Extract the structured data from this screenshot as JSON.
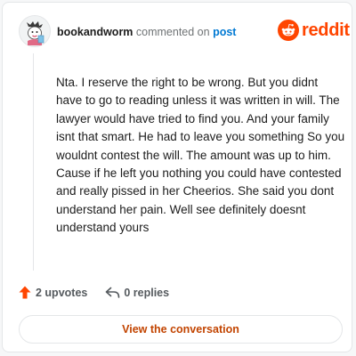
{
  "header": {
    "username": "bookandworm",
    "action_text": "commented on",
    "post_link": "post"
  },
  "brand": {
    "wordmark": "reddit",
    "color": "#ff4500",
    "icon": "reddit-snoo-icon"
  },
  "comment": {
    "body": "Nta. I reserve the right to be wrong. But you didnt have to go to reading unless it was written in will. The lawyer would have tried to find you. And your family isnt that smart. He had to leave you something So you wouldnt contest the will. The amount was up to him. Cause if he left you nothing you could have contested and really pissed in her Cheerios. She said you dont understand her pain. Well see definitely doesnt understand yours"
  },
  "actions": {
    "upvotes": "2 upvotes",
    "replies": "0 replies",
    "upvote_icon": "upvote-arrow-icon",
    "reply_icon": "reply-arrow-icon",
    "upvote_color": "#ff4500"
  },
  "cta": {
    "label": "View the conversation",
    "color": "#c24400"
  },
  "user": {
    "avatar_icon": "avatar-icon"
  }
}
